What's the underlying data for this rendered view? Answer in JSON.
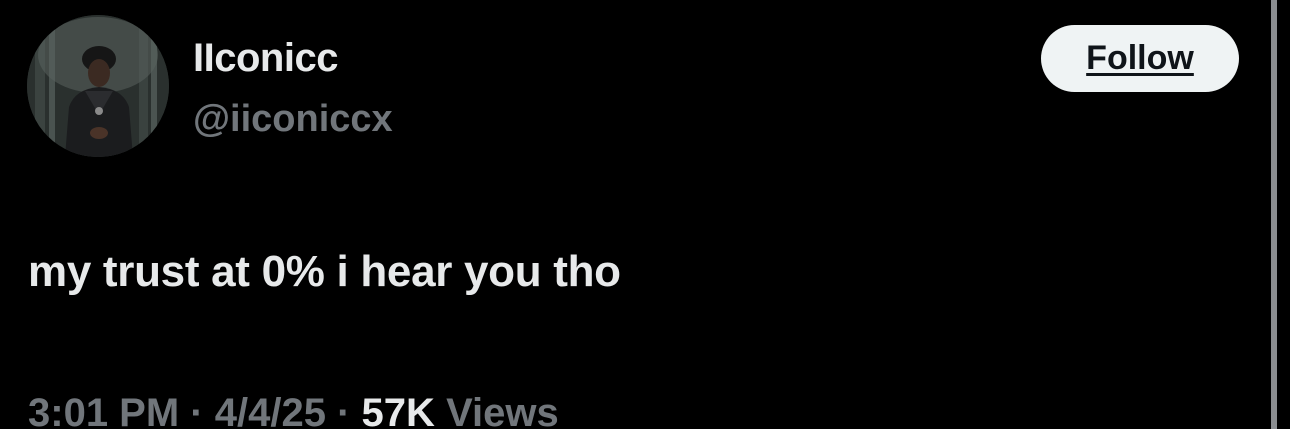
{
  "author": {
    "display_name": "IIconicc",
    "handle": "@iiconiccx",
    "avatar_icon": "profile-photo"
  },
  "follow_button": {
    "label": "Follow"
  },
  "tweet": {
    "text": "my trust at 0% i hear you tho"
  },
  "meta": {
    "time": "3:01 PM",
    "separator": "·",
    "date": "4/4/25",
    "views_count": "57K",
    "views_label": "Views"
  },
  "colors": {
    "background": "#000000",
    "primary_text": "#e7e9ea",
    "secondary_text": "#71767b",
    "button_bg": "#eff3f4",
    "button_text": "#0f1419"
  }
}
